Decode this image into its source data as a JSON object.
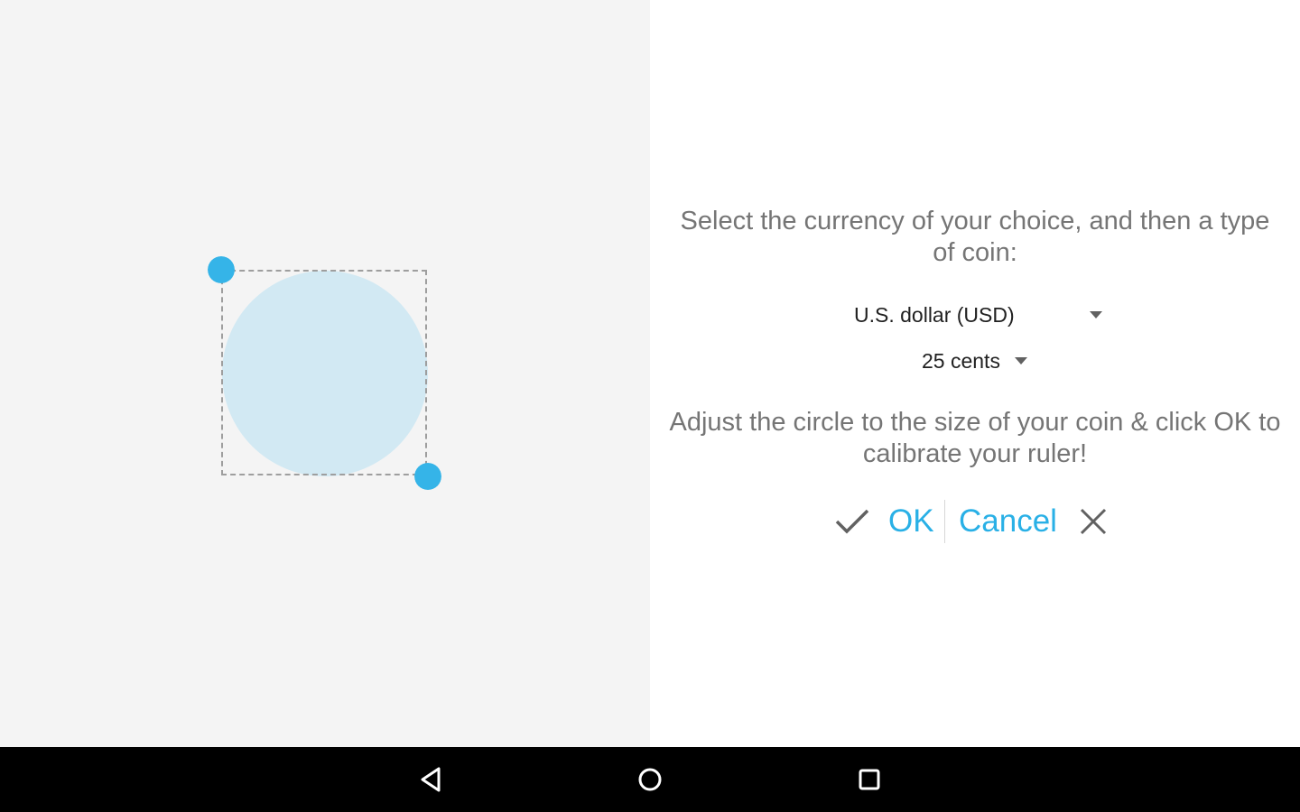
{
  "calibration": {
    "coin_fill": "#d2e9f3",
    "handle_color": "#35b4e8",
    "box_border_color": "#9e9e9e"
  },
  "settings": {
    "instruction_select": "Select the currency of your choice, and then a type of coin:",
    "currency": {
      "selected": "U.S. dollar (USD)",
      "icon": "dropdown-arrow-icon"
    },
    "coin": {
      "selected": "25 cents",
      "icon": "dropdown-arrow-icon"
    },
    "instruction_adjust": "Adjust the circle to the size of your coin & click OK to calibrate your ruler!",
    "ok": {
      "label": "OK",
      "icon": "check-icon"
    },
    "cancel": {
      "label": "Cancel",
      "icon": "close-icon"
    },
    "accent_color": "#29b0e6"
  },
  "navigation": {
    "back": "back-icon",
    "home": "home-icon",
    "recents": "recents-icon"
  }
}
